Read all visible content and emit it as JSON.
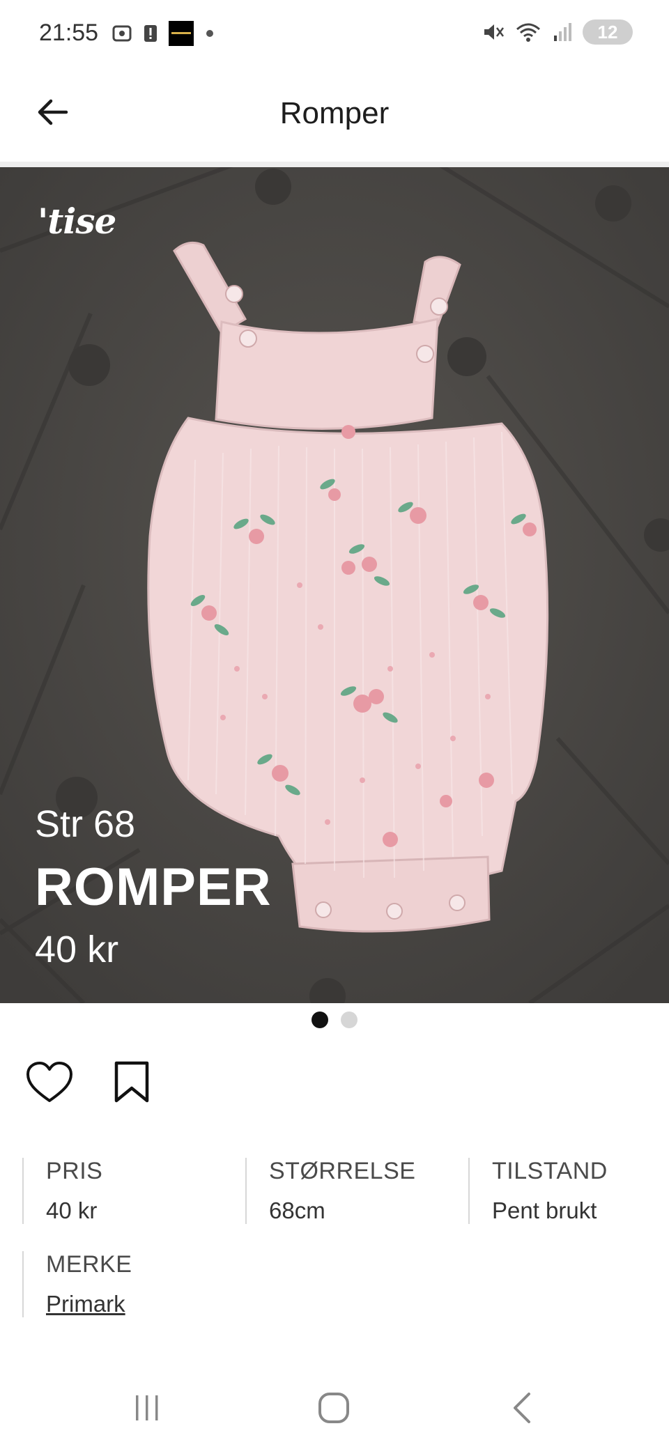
{
  "status_bar": {
    "time": "21:55",
    "battery": "12",
    "left_icons": [
      "screenshot-icon",
      "alert-icon",
      "app-thumbnail-icon",
      "dot-icon"
    ],
    "right_icons": [
      "mute-icon",
      "wifi-icon",
      "signal-icon"
    ]
  },
  "header": {
    "title": "Romper",
    "back_icon": "arrow-left-icon"
  },
  "image": {
    "logo": "'tise",
    "overlay_size": "Str 68",
    "overlay_name": "ROMPER",
    "overlay_price": "40 kr",
    "pager": {
      "count": 2,
      "active": 0
    }
  },
  "actions": {
    "like_icon": "heart-icon",
    "save_icon": "bookmark-icon"
  },
  "details": {
    "price": {
      "label": "PRIS",
      "value": "40 kr"
    },
    "size": {
      "label": "STØRRELSE",
      "value": "68cm"
    },
    "condition": {
      "label": "TILSTAND",
      "value": "Pent brukt"
    },
    "brand": {
      "label": "MERKE",
      "value": "Primark"
    }
  },
  "nav_bar": {
    "icons": [
      "recent-apps-icon",
      "home-icon",
      "back-icon"
    ]
  },
  "colors": {
    "background": "#ffffff",
    "photo_background": "#4a4845",
    "romper_pink": "#f1d5d6",
    "text": "#1b1b1b"
  }
}
